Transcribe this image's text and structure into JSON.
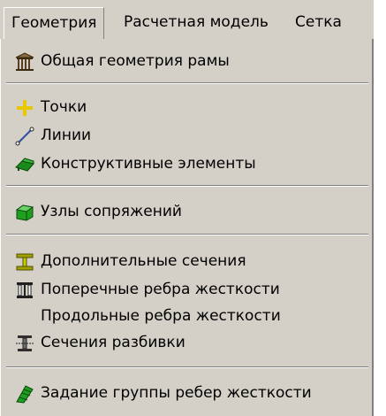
{
  "menubar": {
    "tabs": [
      {
        "label": "Геометрия"
      },
      {
        "label": "Расчетная модель"
      },
      {
        "label": "Сетка"
      }
    ]
  },
  "menu": {
    "items": [
      {
        "label": "Общая геометрия рамы",
        "icon": "frame-building-icon"
      },
      {
        "label": "Точки",
        "icon": "point-icon",
        "color": "#e8c800"
      },
      {
        "label": "Линии",
        "icon": "line-icon"
      },
      {
        "label": "Конструктивные элементы",
        "icon": "structural-element-icon",
        "color": "#1a8a1a"
      },
      {
        "label": "Узлы сопряжений",
        "icon": "joint-node-icon",
        "color": "#1f9f1f"
      },
      {
        "label": "Дополнительные сечения",
        "icon": "additional-section-icon",
        "color": "#a0a000"
      },
      {
        "label": "Поперечные ребра жесткости",
        "icon": "transverse-stiffener-icon"
      },
      {
        "label": "Продольные ребра жесткости"
      },
      {
        "label": "Сечения разбивки",
        "icon": "split-section-icon"
      },
      {
        "label": "Задание группы ребер жесткости",
        "icon": "stiffener-group-icon",
        "color": "#1f9f1f"
      }
    ]
  }
}
